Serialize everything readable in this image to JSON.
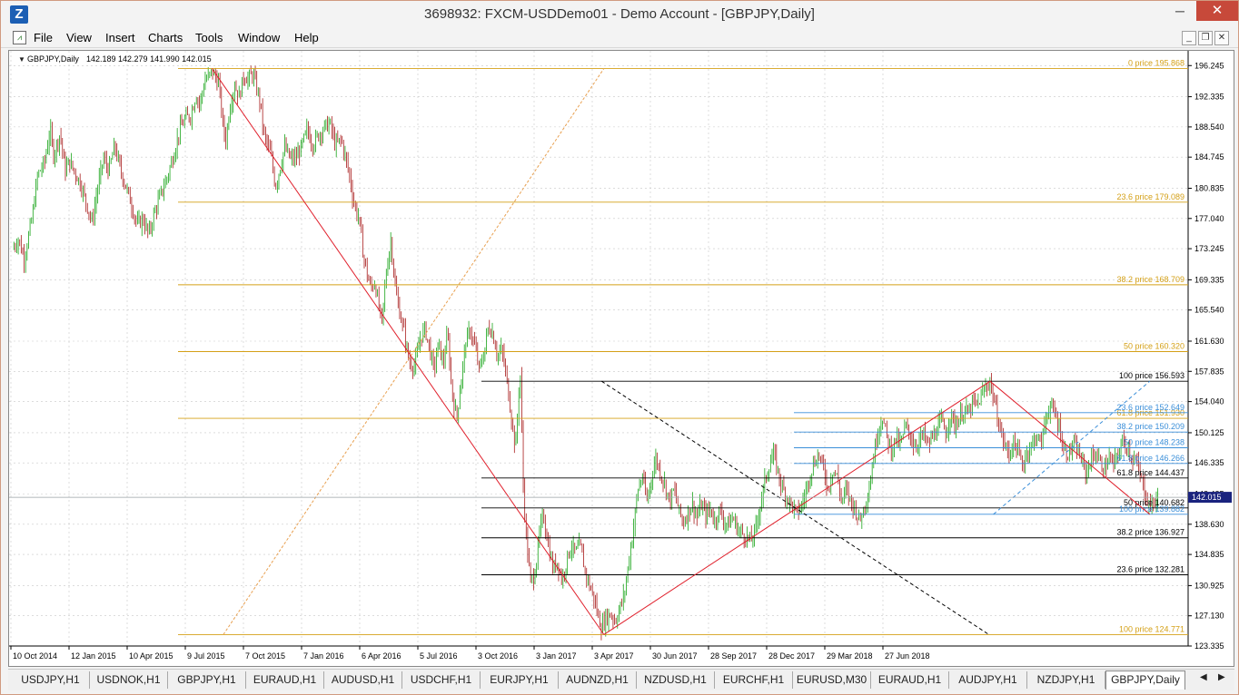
{
  "window": {
    "title": "3698932: FXCM-USDDemo01 - Demo Account - [GBPJPY,Daily]",
    "app_icon_glyph": "Z",
    "minimize_glyph": "─",
    "maximize_glyph": "☐",
    "close_glyph": "✕"
  },
  "menu": {
    "items": [
      "File",
      "View",
      "Insert",
      "Charts",
      "Tools",
      "Window",
      "Help"
    ],
    "mdi_minimize": "_",
    "mdi_restore": "❐",
    "mdi_close": "✕"
  },
  "chart_info": {
    "symbol": "GBPJPY,Daily",
    "ohlc": "142.189 142.279 141.990 142.015"
  },
  "colors": {
    "bull_candle": "#18a418",
    "bear_candle": "#a81c1c",
    "fib_primary": "#d4a017",
    "fib_secondary": "#000000",
    "fib_tertiary": "#3b8fd9",
    "trend_line": "#e0202c",
    "price_marker_bg": "#1a237e"
  },
  "chart_data": {
    "type": "candlestick",
    "symbol": "GBPJPY",
    "timeframe": "Daily",
    "last_price": "142.015",
    "ylim": [
      123.335,
      198.1
    ],
    "y_ticks": [
      "196.245",
      "192.335",
      "188.540",
      "184.745",
      "180.835",
      "177.040",
      "173.245",
      "169.335",
      "165.540",
      "161.630",
      "157.835",
      "154.040",
      "150.125",
      "146.335",
      "142.425",
      "138.630",
      "134.835",
      "130.925",
      "127.130",
      "123.335"
    ],
    "x_ticks": [
      "10 Oct 2014",
      "12 Jan 2015",
      "10 Apr 2015",
      "9 Jul 2015",
      "7 Oct 2015",
      "7 Jan 2016",
      "6 Apr 2016",
      "5 Jul 2016",
      "3 Oct 2016",
      "3 Jan 2017",
      "3 Apr 2017",
      "30 Jun 2017",
      "28 Sep 2017",
      "28 Dec 2017",
      "29 Mar 2018",
      "27 Jun 2018"
    ],
    "close_path": [
      [
        0,
        173.2
      ],
      [
        5,
        174.5
      ],
      [
        10,
        172.0
      ],
      [
        17,
        177.0
      ],
      [
        22,
        182.5
      ],
      [
        28,
        184.0
      ],
      [
        33,
        188.2
      ],
      [
        36,
        185.0
      ],
      [
        42,
        187.8
      ],
      [
        46,
        183.0
      ],
      [
        50,
        184.2
      ],
      [
        60,
        181.4
      ],
      [
        66,
        178.5
      ],
      [
        70,
        176.5
      ],
      [
        74,
        180.0
      ],
      [
        80,
        184.6
      ],
      [
        85,
        183.0
      ],
      [
        90,
        186.2
      ],
      [
        95,
        183.2
      ],
      [
        100,
        181.0
      ],
      [
        104,
        179.2
      ],
      [
        110,
        176.2
      ],
      [
        115,
        177.0
      ],
      [
        120,
        175.0
      ],
      [
        126,
        178.2
      ],
      [
        132,
        180.5
      ],
      [
        137,
        182.5
      ],
      [
        142,
        185.0
      ],
      [
        147,
        188.0
      ],
      [
        152,
        189.5
      ],
      [
        157,
        190.0
      ],
      [
        162,
        192.6
      ],
      [
        165,
        191.4
      ],
      [
        170,
        194.5
      ],
      [
        173,
        194.8
      ],
      [
        176,
        195.5
      ],
      [
        182,
        194.0
      ],
      [
        185,
        189.5
      ],
      [
        188,
        186.7
      ],
      [
        192,
        191.4
      ],
      [
        196,
        193.8
      ],
      [
        200,
        192.3
      ],
      [
        204,
        195.0
      ],
      [
        208,
        194.5
      ],
      [
        212,
        195.2
      ],
      [
        218,
        192.0
      ],
      [
        222,
        187.5
      ],
      [
        228,
        185.0
      ],
      [
        232,
        181.0
      ],
      [
        236,
        183.4
      ],
      [
        240,
        186.0
      ],
      [
        245,
        184.5
      ],
      [
        250,
        184.6
      ],
      [
        255,
        186.0
      ],
      [
        260,
        188.2
      ],
      [
        265,
        186.3
      ],
      [
        270,
        187.5
      ],
      [
        275,
        188.5
      ],
      [
        280,
        189.0
      ],
      [
        285,
        186.2
      ],
      [
        290,
        187.0
      ],
      [
        295,
        184.0
      ],
      [
        298,
        182.0
      ],
      [
        300,
        180.0
      ],
      [
        303,
        178.0
      ],
      [
        306,
        177.0
      ],
      [
        309,
        173.0
      ],
      [
        313,
        170.0
      ],
      [
        316,
        168.3
      ],
      [
        320,
        169.0
      ],
      [
        323,
        166.0
      ],
      [
        326,
        164.0
      ],
      [
        330,
        170.5
      ],
      [
        334,
        174.4
      ],
      [
        338,
        168.0
      ],
      [
        342,
        165.0
      ],
      [
        346,
        162.5
      ],
      [
        350,
        159.0
      ],
      [
        355,
        158.5
      ],
      [
        360,
        162.0
      ],
      [
        364,
        163.2
      ],
      [
        368,
        160.8
      ],
      [
        372,
        158.0
      ],
      [
        376,
        161.4
      ],
      [
        380,
        158.7
      ],
      [
        384,
        162.5
      ],
      [
        388,
        155.0
      ],
      [
        392,
        152.0
      ],
      [
        396,
        156.7
      ],
      [
        400,
        161.5
      ],
      [
        404,
        163.0
      ],
      [
        408,
        161.0
      ],
      [
        412,
        158.0
      ],
      [
        416,
        160.0
      ],
      [
        420,
        163.5
      ],
      [
        424,
        162.6
      ],
      [
        428,
        159.8
      ],
      [
        432,
        160.5
      ],
      [
        436,
        157.0
      ],
      [
        440,
        152.5
      ],
      [
        444,
        148.0
      ],
      [
        448,
        158.3
      ],
      [
        451,
        142.5
      ],
      [
        454,
        136.0
      ],
      [
        457,
        131.5
      ],
      [
        460,
        132.0
      ],
      [
        463,
        134.5
      ],
      [
        466,
        138.5
      ],
      [
        469,
        139.5
      ],
      [
        473,
        136.0
      ],
      [
        477,
        133.0
      ],
      [
        481,
        134.0
      ],
      [
        485,
        131.5
      ],
      [
        489,
        134.0
      ],
      [
        493,
        136.0
      ],
      [
        497,
        135.0
      ],
      [
        501,
        136.0
      ],
      [
        505,
        133.0
      ],
      [
        509,
        131.0
      ],
      [
        513,
        129.5
      ],
      [
        517,
        127.0
      ],
      [
        520,
        125.6
      ],
      [
        524,
        127.0
      ],
      [
        528,
        127.3
      ],
      [
        532,
        126.5
      ],
      [
        536,
        128.0
      ],
      [
        540,
        129.8
      ],
      [
        544,
        134.0
      ],
      [
        548,
        138.0
      ],
      [
        552,
        143.0
      ],
      [
        556,
        144.6
      ],
      [
        560,
        141.5
      ],
      [
        564,
        144.5
      ],
      [
        568,
        147.0
      ],
      [
        572,
        145.0
      ],
      [
        576,
        143.6
      ],
      [
        580,
        141.5
      ],
      [
        584,
        143.0
      ],
      [
        588,
        140.5
      ],
      [
        592,
        138.8
      ],
      [
        596,
        140.0
      ],
      [
        600,
        141.2
      ],
      [
        604,
        139.5
      ],
      [
        608,
        141.0
      ],
      [
        612,
        139.8
      ],
      [
        616,
        140.5
      ],
      [
        620,
        139.0
      ],
      [
        624,
        140.5
      ],
      [
        628,
        139.0
      ],
      [
        632,
        138.6
      ],
      [
        636,
        139.5
      ],
      [
        640,
        138.0
      ],
      [
        644,
        137.5
      ],
      [
        648,
        137.0
      ],
      [
        652,
        136.5
      ],
      [
        656,
        138.0
      ],
      [
        660,
        141.0
      ],
      [
        664,
        144.0
      ],
      [
        668,
        146.0
      ],
      [
        672,
        147.5
      ],
      [
        676,
        145.0
      ],
      [
        680,
        143.0
      ],
      [
        684,
        142.0
      ],
      [
        688,
        141.0
      ],
      [
        692,
        140.0
      ],
      [
        696,
        140.8
      ],
      [
        700,
        142.5
      ],
      [
        704,
        145.0
      ],
      [
        708,
        146.5
      ],
      [
        712,
        147.4
      ],
      [
        716,
        145.5
      ],
      [
        720,
        143.0
      ],
      [
        724,
        145.5
      ],
      [
        728,
        144.6
      ],
      [
        732,
        141.5
      ],
      [
        736,
        143.0
      ],
      [
        740,
        141.5
      ],
      [
        744,
        140.5
      ],
      [
        748,
        139.0
      ],
      [
        752,
        141.0
      ],
      [
        756,
        143.0
      ],
      [
        760,
        147.0
      ],
      [
        764,
        150.5
      ],
      [
        768,
        152.0
      ],
      [
        772,
        149.5
      ],
      [
        776,
        148.0
      ],
      [
        780,
        149.5
      ],
      [
        784,
        148.5
      ],
      [
        788,
        151.0
      ],
      [
        792,
        150.0
      ],
      [
        796,
        148.5
      ],
      [
        800,
        149.0
      ],
      [
        804,
        150.0
      ],
      [
        808,
        148.5
      ],
      [
        812,
        149.5
      ],
      [
        816,
        150.5
      ],
      [
        820,
        151.6
      ],
      [
        824,
        150.0
      ],
      [
        828,
        152.5
      ],
      [
        832,
        151.0
      ],
      [
        836,
        152.0
      ],
      [
        840,
        153.0
      ],
      [
        844,
        152.5
      ],
      [
        848,
        154.0
      ],
      [
        852,
        153.5
      ],
      [
        856,
        155.0
      ],
      [
        860,
        156.0
      ],
      [
        863,
        156.6
      ],
      [
        866,
        154.5
      ],
      [
        869,
        152.5
      ],
      [
        872,
        150.5
      ],
      [
        876,
        148.5
      ],
      [
        880,
        147.5
      ],
      [
        884,
        149.0
      ],
      [
        888,
        147.5
      ],
      [
        892,
        146.0
      ],
      [
        896,
        148.0
      ],
      [
        900,
        148.5
      ],
      [
        904,
        150.0
      ],
      [
        908,
        148.5
      ],
      [
        912,
        152.0
      ],
      [
        916,
        153.5
      ],
      [
        920,
        152.5
      ],
      [
        924,
        151.0
      ],
      [
        928,
        148.0
      ],
      [
        932,
        147.5
      ],
      [
        936,
        148.5
      ],
      [
        940,
        148.0
      ],
      [
        944,
        146.5
      ],
      [
        948,
        145.0
      ],
      [
        952,
        146.8
      ],
      [
        956,
        147.5
      ],
      [
        960,
        146.5
      ],
      [
        964,
        145.5
      ],
      [
        968,
        147.0
      ],
      [
        972,
        146.0
      ],
      [
        976,
        147.5
      ],
      [
        980,
        149.0
      ],
      [
        984,
        148.5
      ],
      [
        988,
        147.0
      ],
      [
        992,
        146.5
      ],
      [
        996,
        144.5
      ],
      [
        1000,
        142.5
      ],
      [
        1004,
        140.8
      ],
      [
        1008,
        141.5
      ],
      [
        1012,
        142.0
      ]
    ],
    "levels": [
      {
        "group": "primary",
        "label": "0 price 195.868",
        "price": 195.868
      },
      {
        "group": "primary",
        "label": "23.6 price 179.089",
        "price": 179.089
      },
      {
        "group": "primary",
        "label": "38.2 price 168.709",
        "price": 168.709
      },
      {
        "group": "primary",
        "label": "50 price 160.320",
        "price": 160.32
      },
      {
        "group": "primary",
        "label": "61.8 price 151.930",
        "price": 151.93
      },
      {
        "group": "primary",
        "label": "100 price 124.771",
        "price": 124.771
      },
      {
        "group": "secondary",
        "label": "100 price 156.593",
        "price": 156.593
      },
      {
        "group": "secondary",
        "label": "61.8 price 144.437",
        "price": 144.437
      },
      {
        "group": "secondary",
        "label": "50 price 140.682",
        "price": 140.682
      },
      {
        "group": "secondary",
        "label": "38.2 price 136.927",
        "price": 136.927
      },
      {
        "group": "secondary",
        "label": "23.6 price 132.281",
        "price": 132.281
      },
      {
        "group": "tertiary",
        "label": "23.6 price 152.649",
        "price": 152.649
      },
      {
        "group": "tertiary",
        "label": "38.2 price 150.209",
        "price": 150.209
      },
      {
        "group": "tertiary",
        "label": "50 price 148.238",
        "price": 148.238
      },
      {
        "group": "tertiary",
        "label": "61.8 price 146.266",
        "price": 146.266
      },
      {
        "group": "tertiary",
        "label": "100 price 139.882",
        "price": 139.882
      }
    ]
  },
  "tabs": {
    "items": [
      "USDJPY,H1",
      "USDNOK,H1",
      "GBPJPY,H1",
      "EURAUD,H1",
      "AUDUSD,H1",
      "USDCHF,H1",
      "EURJPY,H1",
      "AUDNZD,H1",
      "NZDUSD,H1",
      "EURCHF,H1",
      "EURUSD,M30",
      "EURAUD,H1",
      "AUDJPY,H1",
      "NZDJPY,H1",
      "GBPJPY,Daily"
    ],
    "active": 14,
    "nav_left": "◀",
    "nav_right": "▶"
  }
}
